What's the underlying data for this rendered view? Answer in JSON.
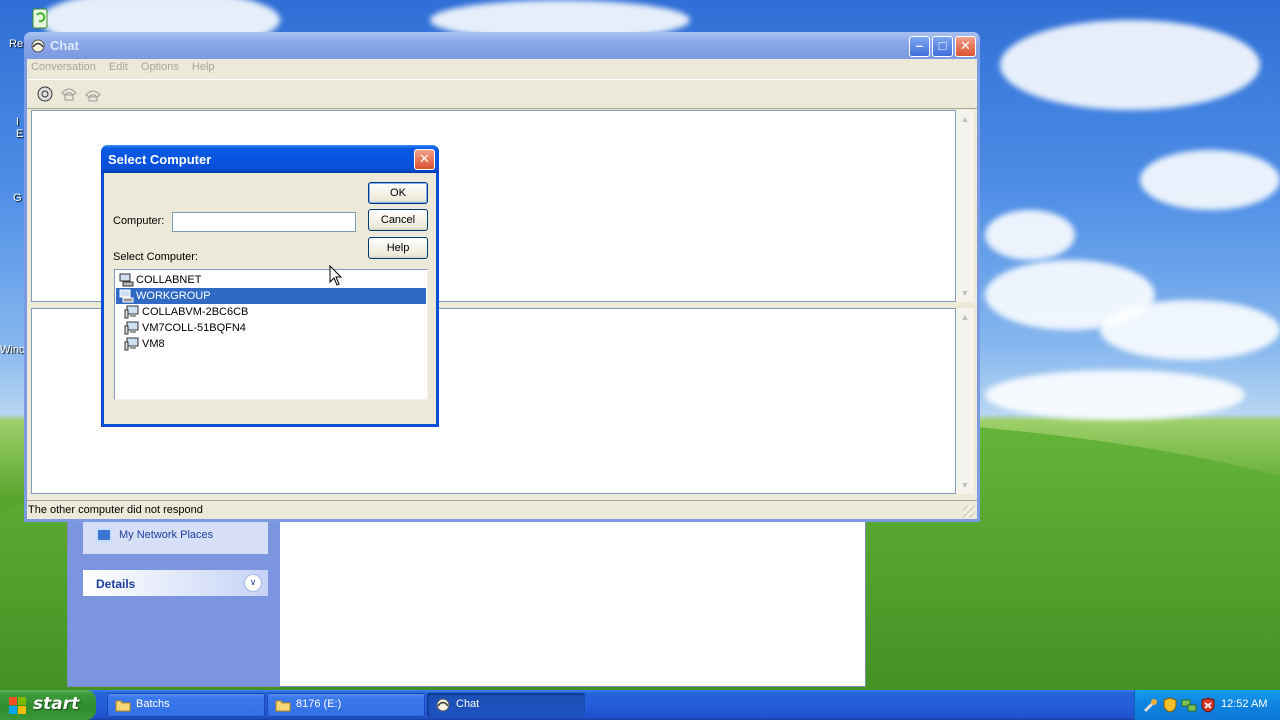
{
  "desktop": {
    "icon_labels": [
      "Re",
      "I\nE",
      "G",
      "Winc"
    ]
  },
  "explorer": {
    "my_network_places": "My Network Places",
    "details": "Details"
  },
  "chat_window": {
    "title": "Chat",
    "menu": [
      "Conversation",
      "Edit",
      "Options",
      "Help"
    ],
    "toolbar_icons": [
      "dial-icon",
      "answer-icon",
      "hang-up-icon"
    ],
    "status_text": "The other computer did not respond"
  },
  "dialog": {
    "title": "Select Computer",
    "ok_label": "OK",
    "cancel_label": "Cancel",
    "help_label": "Help",
    "computer_label": "Computer:",
    "computer_value": "",
    "select_label": "Select Computer:",
    "tree": [
      {
        "label": "COLLABNET",
        "level": 0,
        "selected": false,
        "icon": "network-icon"
      },
      {
        "label": "WORKGROUP",
        "level": 0,
        "selected": true,
        "icon": "workgroup-icon"
      },
      {
        "label": "COLLABVM-2BC6CB",
        "level": 1,
        "selected": false,
        "icon": "computer-icon"
      },
      {
        "label": "VM7COLL-51BQFN4",
        "level": 1,
        "selected": false,
        "icon": "computer-icon"
      },
      {
        "label": "VM8",
        "level": 1,
        "selected": false,
        "icon": "computer-icon"
      }
    ]
  },
  "taskbar": {
    "start_label": "start",
    "tasks": [
      {
        "label": "Batchs",
        "icon": "folder-icon",
        "active": false
      },
      {
        "label": "8176 (E:)",
        "icon": "folder-icon",
        "active": false
      },
      {
        "label": "Chat",
        "icon": "chat-icon",
        "active": true
      }
    ],
    "clock": "12:52 AM"
  }
}
